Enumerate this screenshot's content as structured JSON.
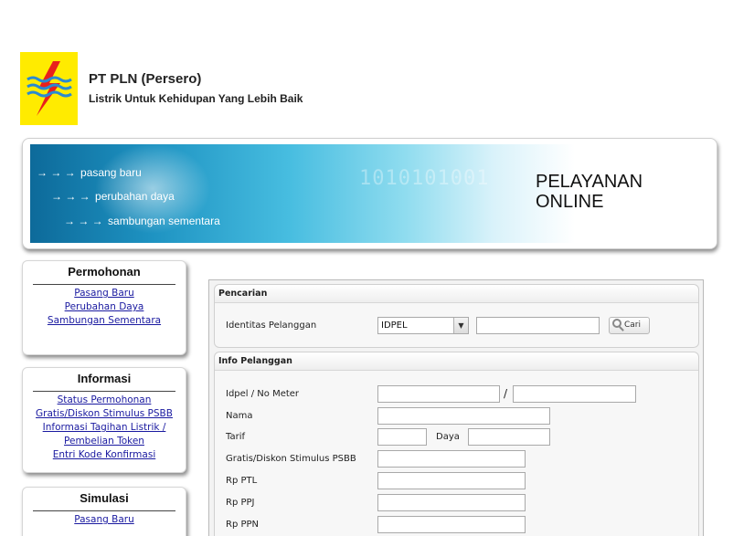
{
  "header": {
    "company": "PT PLN (Persero)",
    "tagline": "Listrik Untuk Kehidupan Yang Lebih Baik",
    "logo_icon": "pln-lightning-logo",
    "logo_color": "#ffeb00"
  },
  "banner": {
    "links": [
      "pasang baru",
      "perubahan daya",
      "sambungan sementara"
    ],
    "title_line1": "PELAYANAN",
    "title_line2": "ONLINE",
    "arrow": "→ → →",
    "digits": "1010101001"
  },
  "sidebar": {
    "permohonan": {
      "title": "Permohonan",
      "items": [
        "Pasang Baru",
        "Perubahan Daya",
        "Sambungan Sementara"
      ]
    },
    "informasi": {
      "title": "Informasi",
      "items": [
        "Status Permohonan",
        "Gratis/Diskon Stimulus PSBB",
        "Informasi Tagihan Listrik /",
        "Pembelian Token",
        "Entri Kode Konfirmasi"
      ]
    },
    "simulasi": {
      "title": "Simulasi",
      "items": [
        "Pasang Baru"
      ]
    }
  },
  "pencarian": {
    "title": "Pencarian",
    "label": "Identitas Pelanggan",
    "select_value": "IDPEL",
    "search_value": "",
    "button_label": "Cari"
  },
  "info": {
    "title": "Info Pelanggan",
    "idpel_label": "Idpel / No Meter",
    "separator": "/",
    "nama_label": "Nama",
    "tarif_label": "Tarif",
    "daya_label": "Daya",
    "stimulus_label": "Gratis/Diskon Stimulus PSBB",
    "rp_ptl_label": "Rp PTL",
    "rp_ppj_label": "Rp PPJ",
    "rp_ppn_label": "Rp PPN"
  }
}
